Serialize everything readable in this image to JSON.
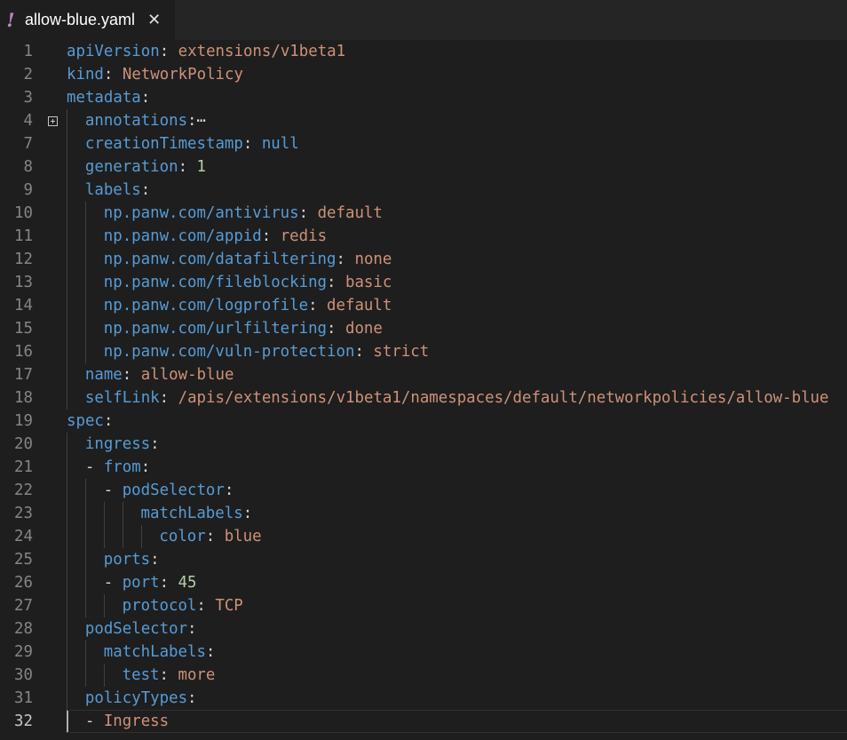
{
  "tab": {
    "warning_icon": "!",
    "title": "allow-blue.yaml",
    "close_icon": "✕"
  },
  "colors": {
    "background": "#1e1e1e",
    "tab_bar": "#252526",
    "key": "#569cd6",
    "string": "#ce9178",
    "number": "#b5cea8",
    "punctuation": "#d4d4d4",
    "line_number": "#858585",
    "warning": "#c586c0"
  },
  "editor": {
    "active_line": 32,
    "lines": [
      {
        "num": "1",
        "indent": 0,
        "tokens": [
          {
            "t": "apiVersion",
            "c": "k"
          },
          {
            "t": ": ",
            "c": "p"
          },
          {
            "t": "extensions/v1beta1",
            "c": "s"
          }
        ]
      },
      {
        "num": "2",
        "indent": 0,
        "tokens": [
          {
            "t": "kind",
            "c": "k"
          },
          {
            "t": ": ",
            "c": "p"
          },
          {
            "t": "NetworkPolicy",
            "c": "s"
          }
        ]
      },
      {
        "num": "3",
        "indent": 0,
        "tokens": [
          {
            "t": "metadata",
            "c": "k"
          },
          {
            "t": ":",
            "c": "p"
          }
        ]
      },
      {
        "num": "4",
        "indent": 1,
        "folded": true,
        "tokens": [
          {
            "t": "annotations",
            "c": "k"
          },
          {
            "t": ":",
            "c": "p"
          },
          {
            "t": "⋯",
            "c": "e"
          }
        ]
      },
      {
        "num": "7",
        "indent": 1,
        "tokens": [
          {
            "t": "creationTimestamp",
            "c": "k"
          },
          {
            "t": ": ",
            "c": "p"
          },
          {
            "t": "null",
            "c": "c"
          }
        ]
      },
      {
        "num": "8",
        "indent": 1,
        "tokens": [
          {
            "t": "generation",
            "c": "k"
          },
          {
            "t": ": ",
            "c": "p"
          },
          {
            "t": "1",
            "c": "n"
          }
        ]
      },
      {
        "num": "9",
        "indent": 1,
        "tokens": [
          {
            "t": "labels",
            "c": "k"
          },
          {
            "t": ":",
            "c": "p"
          }
        ]
      },
      {
        "num": "10",
        "indent": 2,
        "tokens": [
          {
            "t": "np.panw.com/antivirus",
            "c": "k"
          },
          {
            "t": ": ",
            "c": "p"
          },
          {
            "t": "default",
            "c": "s"
          }
        ]
      },
      {
        "num": "11",
        "indent": 2,
        "tokens": [
          {
            "t": "np.panw.com/appid",
            "c": "k"
          },
          {
            "t": ": ",
            "c": "p"
          },
          {
            "t": "redis",
            "c": "s"
          }
        ]
      },
      {
        "num": "12",
        "indent": 2,
        "tokens": [
          {
            "t": "np.panw.com/datafiltering",
            "c": "k"
          },
          {
            "t": ": ",
            "c": "p"
          },
          {
            "t": "none",
            "c": "s"
          }
        ]
      },
      {
        "num": "13",
        "indent": 2,
        "tokens": [
          {
            "t": "np.panw.com/fileblocking",
            "c": "k"
          },
          {
            "t": ": ",
            "c": "p"
          },
          {
            "t": "basic",
            "c": "s"
          }
        ]
      },
      {
        "num": "14",
        "indent": 2,
        "tokens": [
          {
            "t": "np.panw.com/logprofile",
            "c": "k"
          },
          {
            "t": ": ",
            "c": "p"
          },
          {
            "t": "default",
            "c": "s"
          }
        ]
      },
      {
        "num": "15",
        "indent": 2,
        "tokens": [
          {
            "t": "np.panw.com/urlfiltering",
            "c": "k"
          },
          {
            "t": ": ",
            "c": "p"
          },
          {
            "t": "done",
            "c": "s"
          }
        ]
      },
      {
        "num": "16",
        "indent": 2,
        "tokens": [
          {
            "t": "np.panw.com/vuln-protection",
            "c": "k"
          },
          {
            "t": ": ",
            "c": "p"
          },
          {
            "t": "strict",
            "c": "s"
          }
        ]
      },
      {
        "num": "17",
        "indent": 1,
        "tokens": [
          {
            "t": "name",
            "c": "k"
          },
          {
            "t": ": ",
            "c": "p"
          },
          {
            "t": "allow-blue",
            "c": "s"
          }
        ]
      },
      {
        "num": "18",
        "indent": 1,
        "tokens": [
          {
            "t": "selfLink",
            "c": "k"
          },
          {
            "t": ": ",
            "c": "p"
          },
          {
            "t": "/apis/extensions/v1beta1/namespaces/default/networkpolicies/allow-blue",
            "c": "s"
          }
        ]
      },
      {
        "num": "19",
        "indent": 0,
        "tokens": [
          {
            "t": "spec",
            "c": "k"
          },
          {
            "t": ":",
            "c": "p"
          }
        ]
      },
      {
        "num": "20",
        "indent": 1,
        "tokens": [
          {
            "t": "ingress",
            "c": "k"
          },
          {
            "t": ":",
            "c": "p"
          }
        ]
      },
      {
        "num": "21",
        "indent": 1,
        "tokens": [
          {
            "t": "- ",
            "c": "d"
          },
          {
            "t": "from",
            "c": "k"
          },
          {
            "t": ":",
            "c": "p"
          }
        ]
      },
      {
        "num": "22",
        "indent": 2,
        "tokens": [
          {
            "t": "- ",
            "c": "d"
          },
          {
            "t": "podSelector",
            "c": "k"
          },
          {
            "t": ":",
            "c": "p"
          }
        ]
      },
      {
        "num": "23",
        "indent": 4,
        "tokens": [
          {
            "t": "matchLabels",
            "c": "k"
          },
          {
            "t": ":",
            "c": "p"
          }
        ]
      },
      {
        "num": "24",
        "indent": 5,
        "tokens": [
          {
            "t": "color",
            "c": "k"
          },
          {
            "t": ": ",
            "c": "p"
          },
          {
            "t": "blue",
            "c": "s"
          }
        ]
      },
      {
        "num": "25",
        "indent": 2,
        "tokens": [
          {
            "t": "ports",
            "c": "k"
          },
          {
            "t": ":",
            "c": "p"
          }
        ]
      },
      {
        "num": "26",
        "indent": 2,
        "tokens": [
          {
            "t": "- ",
            "c": "d"
          },
          {
            "t": "port",
            "c": "k"
          },
          {
            "t": ": ",
            "c": "p"
          },
          {
            "t": "45",
            "c": "n"
          }
        ]
      },
      {
        "num": "27",
        "indent": 3,
        "tokens": [
          {
            "t": "protocol",
            "c": "k"
          },
          {
            "t": ": ",
            "c": "p"
          },
          {
            "t": "TCP",
            "c": "s"
          }
        ]
      },
      {
        "num": "28",
        "indent": 1,
        "tokens": [
          {
            "t": "podSelector",
            "c": "k"
          },
          {
            "t": ":",
            "c": "p"
          }
        ]
      },
      {
        "num": "29",
        "indent": 2,
        "tokens": [
          {
            "t": "matchLabels",
            "c": "k"
          },
          {
            "t": ":",
            "c": "p"
          }
        ]
      },
      {
        "num": "30",
        "indent": 3,
        "tokens": [
          {
            "t": "test",
            "c": "k"
          },
          {
            "t": ": ",
            "c": "p"
          },
          {
            "t": "more",
            "c": "s"
          }
        ]
      },
      {
        "num": "31",
        "indent": 1,
        "tokens": [
          {
            "t": "policyTypes",
            "c": "k"
          },
          {
            "t": ":",
            "c": "p"
          }
        ]
      },
      {
        "num": "32",
        "indent": 1,
        "tokens": [
          {
            "t": "- ",
            "c": "d"
          },
          {
            "t": "Ingress",
            "c": "s"
          }
        ]
      }
    ]
  }
}
